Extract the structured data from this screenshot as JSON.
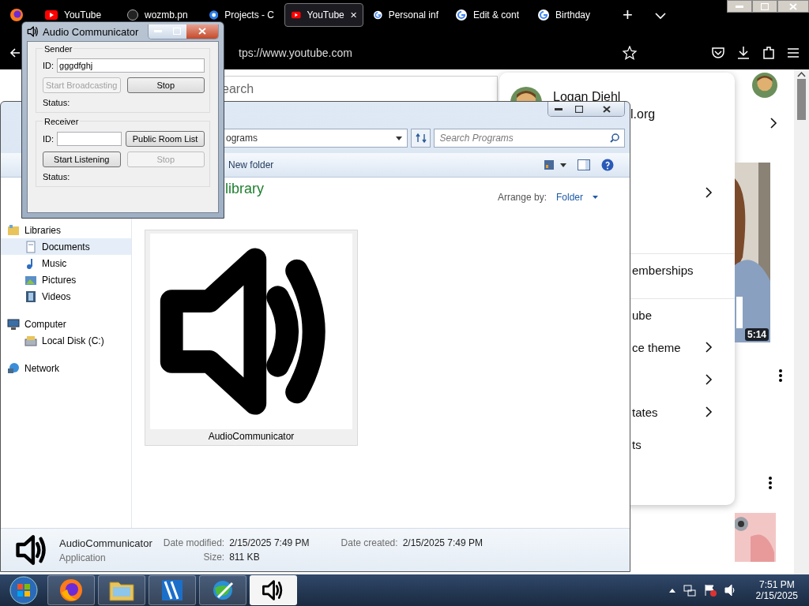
{
  "browser": {
    "tabs": [
      {
        "label": "YouTube",
        "kind": "youtube",
        "selected": false
      },
      {
        "label": "wozmb.pn",
        "kind": "github",
        "selected": false
      },
      {
        "label": "Projects - C",
        "kind": "projects",
        "selected": false
      },
      {
        "label": "YouTube",
        "kind": "youtube",
        "selected": true
      },
      {
        "label": "Personal inf",
        "kind": "google",
        "selected": false
      },
      {
        "label": "Edit & cont",
        "kind": "google",
        "selected": false
      },
      {
        "label": "Birthday",
        "kind": "google",
        "selected": false
      }
    ],
    "new_tab": "+",
    "address": "tps://www.youtube.com",
    "search_placeholder": "earch",
    "account_menu": {
      "name": "Logan Diehl",
      "email": "l.org",
      "items": [
        {
          "chevron": true,
          "divider_before": false
        },
        {
          "label": "emberships",
          "chevron": false,
          "divider_before": true
        },
        {
          "label": "ube",
          "chevron": false,
          "divider_before": true
        },
        {
          "label": "ce theme",
          "chevron": true,
          "divider_before": false
        },
        {
          "chevron": true,
          "divider_before": false
        },
        {
          "label": "tates",
          "chevron": true,
          "divider_before": false
        },
        {
          "label": "ts",
          "chevron": false,
          "divider_before": false
        }
      ]
    },
    "video": {
      "duration": "5:14"
    }
  },
  "explorer": {
    "breadcrumb": "ograms",
    "search_placeholder": "Search Programs",
    "toolbar": [
      "New folder"
    ],
    "heading": "library",
    "arrange_label": "Arrange by:",
    "arrange_value": "Folder",
    "nav": [
      {
        "label": "Libraries",
        "kind": "library",
        "selected": false,
        "children": [
          {
            "label": "Documents",
            "kind": "documents",
            "selected": true
          },
          {
            "label": "Music",
            "kind": "music",
            "selected": false
          },
          {
            "label": "Pictures",
            "kind": "pictures",
            "selected": false
          },
          {
            "label": "Videos",
            "kind": "videos",
            "selected": false
          }
        ]
      },
      {
        "label": "Computer",
        "kind": "computer",
        "selected": false,
        "children": [
          {
            "label": "Local Disk (C:)",
            "kind": "disk",
            "selected": false
          }
        ]
      },
      {
        "label": "Network",
        "kind": "network",
        "selected": false
      }
    ],
    "files": [
      {
        "name": "AudioCommunicator",
        "selected": true
      }
    ],
    "details": {
      "name": "AudioCommunicator",
      "type": "Application",
      "fields": [
        {
          "label": "Date modified:",
          "value": "2/15/2025 7:49 PM"
        },
        {
          "label": "Size:",
          "value": "811 KB"
        },
        {
          "label": "Date created:",
          "value": "2/15/2025 7:49 PM"
        }
      ]
    }
  },
  "audio_communicator": {
    "title": "Audio Communicator",
    "groups": [
      {
        "title": "Sender",
        "id_label": "ID:",
        "id_value": "gggdfghj",
        "buttons": [
          {
            "label": "Start Broadcasting",
            "disabled": true
          },
          {
            "label": "Stop",
            "disabled": false
          }
        ],
        "status_label": "Status:"
      },
      {
        "title": "Receiver",
        "id_label": "ID:",
        "side_button": {
          "label": "Public Room List",
          "disabled": false
        },
        "buttons": [
          {
            "label": "Start Listening",
            "disabled": false
          },
          {
            "label": "Stop",
            "disabled": true
          }
        ],
        "status_label": "Status:"
      }
    ]
  },
  "taskbar": {
    "apps": [
      {
        "kind": "firefox",
        "active": false
      },
      {
        "kind": "explorer",
        "active": false
      },
      {
        "kind": "editor",
        "active": false
      },
      {
        "kind": "globe",
        "active": false
      },
      {
        "kind": "speaker",
        "active": true
      }
    ],
    "time": "7:51 PM",
    "date": "2/15/2025"
  }
}
